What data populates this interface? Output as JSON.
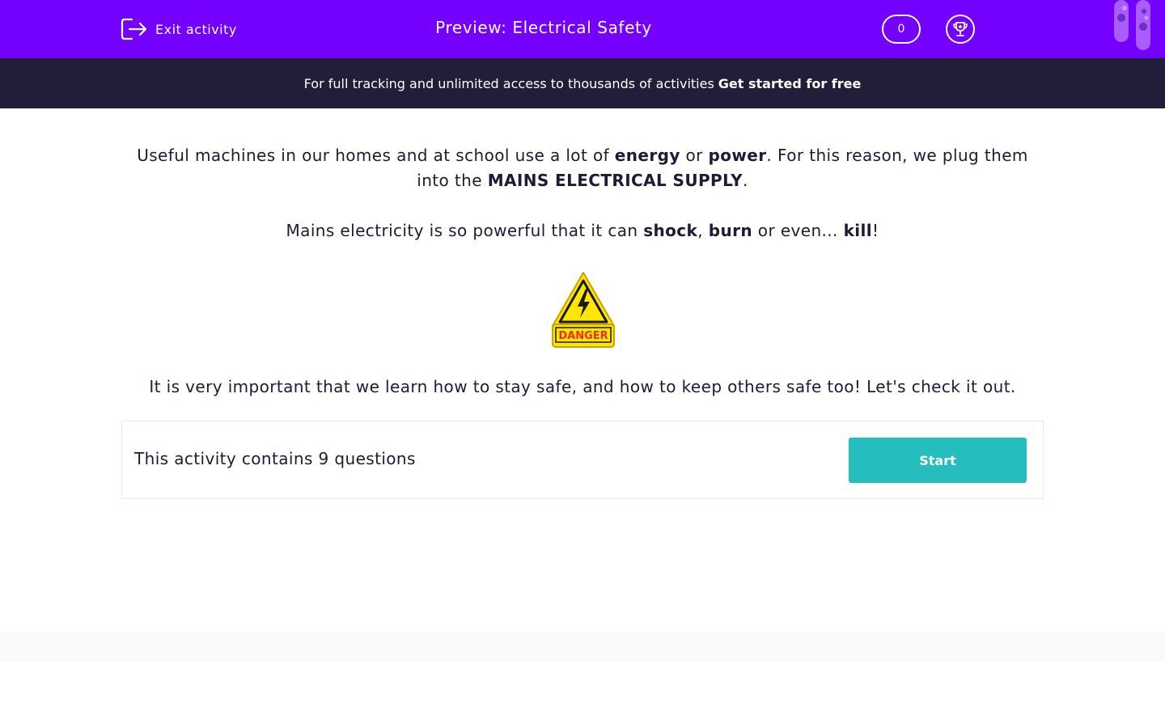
{
  "header": {
    "exit_label": "Exit activity",
    "title": "Preview: Electrical Safety",
    "score": "0",
    "icons": [
      "exit-icon",
      "trophy-icon",
      "test-tubes-icon"
    ]
  },
  "promo": {
    "text": "For full tracking and unlimited access to thousands of activities",
    "cta": "Get started for free"
  },
  "intro": {
    "p1": {
      "t1": "Useful machines in our homes and at school use a lot of ",
      "b1": "energy",
      "t2": " or ",
      "b2": "power",
      "t3": ". For this reason, we plug them into the ",
      "b3": "MAINS ELECTRICAL SUPPLY",
      "t4": "."
    },
    "p2": {
      "t1": "Mains electricity is so powerful that it can ",
      "b1": "shock",
      "t2": ", ",
      "b2": "burn",
      "t3": " or even... ",
      "b3": "kill",
      "t4": "!"
    },
    "sign_text": "DANGER",
    "p3": "It is very important that we learn how to stay safe, and how to keep others safe too!  Let's check it out."
  },
  "activity": {
    "summary": "This activity contains 9 questions",
    "start_label": "Start"
  },
  "colors": {
    "header": "#7400ff",
    "promo": "#231d3a",
    "text": "#1f1a38",
    "start": "#25bdbd",
    "sign_yellow": "#ffe600",
    "sign_red": "#e8301c"
  }
}
